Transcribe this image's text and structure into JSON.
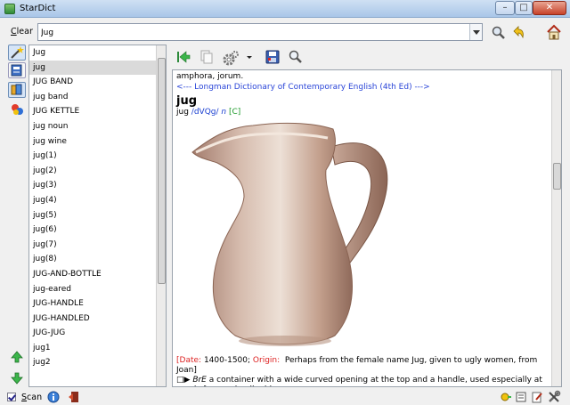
{
  "window": {
    "title": "StarDict"
  },
  "search": {
    "clear_label": "Clear",
    "value": "Jug"
  },
  "wordlist": {
    "items": [
      "Jug",
      "jug",
      "JUG BAND",
      "jug band",
      "JUG KETTLE",
      "jug noun",
      "jug wine",
      "jug(1)",
      "jug(2)",
      "jug(3)",
      "jug(4)",
      "jug(5)",
      "jug(6)",
      "jug(7)",
      "jug(8)",
      "JUG-AND-BOTTLE",
      "jug-eared",
      "JUG-HANDLE",
      "JUG-HANDLED",
      "JUG-JUG",
      "jug1",
      "jug2"
    ],
    "selected_index": 1
  },
  "definition": {
    "prev_line": "amphora, jorum.",
    "dict_header": "<--- Longman Dictionary of Contemporary English (4th Ed) --->",
    "headword": "jug",
    "pron_word": "jug",
    "pron": "/dVQg/",
    "pos": "n",
    "countable": "[C]",
    "etym_date_label": "Date:",
    "etym_date": "1400-1500;",
    "etym_origin_label": "Origin:",
    "etym_origin": "Perhaps from the female name  Jug, given to ugly women, from  Joan]",
    "sense_region": "BrE",
    "sense_text": "a container with a wide curved opening at the top and a handle, used especially at meals for pouring liquids"
  },
  "status": {
    "scan_label": "Scan",
    "scan_checked": true
  },
  "icons": {
    "app": "stardict-icon",
    "lookup": "magnifier-icon",
    "back": "back-arrow-icon",
    "home": "home-icon",
    "sidebar": [
      "wand-icon",
      "dictionary-icon",
      "books-icon",
      "shapes-icon"
    ],
    "toolbar": [
      "go-to-icon",
      "copy-icon",
      "settings-gear-icon",
      "dropdown-arrow-icon",
      "save-icon",
      "find-icon"
    ],
    "nav": [
      "up-arrow-icon",
      "down-arrow-icon"
    ],
    "statusbar": [
      "info-icon",
      "quit-icon",
      "lock-icon",
      "dict-manage-icon",
      "edit-icon",
      "tools-icon"
    ]
  },
  "colors": {
    "link_blue": "#2a45d8",
    "red_label": "#d22222",
    "countable_green": "#1d9a2a",
    "titlebar": "#b9d1ee"
  }
}
